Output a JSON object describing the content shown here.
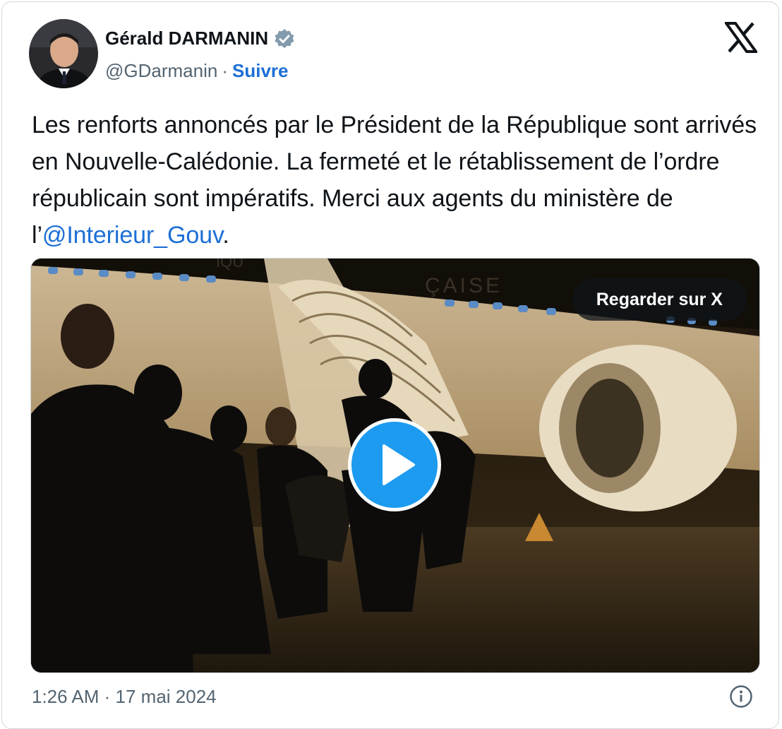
{
  "author": {
    "name": "Gérald DARMANIN",
    "handle": "@GDarmanin",
    "separator": "·",
    "follow_label": "Suivre",
    "verified_icon": "verified-badge-icon"
  },
  "tweet": {
    "text_before_mention": "Les renforts annoncés par le Président de la République sont arrivés en Nouvelle-Calédonie. La fermeté et le rétablissement de l’ordre républicain sont impératifs. Merci aux agents du ministère de l’",
    "mention": "@Interieur_Gouv",
    "text_after_mention": "."
  },
  "media": {
    "watch_label": "Regarder sur X",
    "fuselage_text": "ÇAISE",
    "fuselage_text_left": "IQU"
  },
  "meta": {
    "time": "1:26 AM",
    "separator": "·",
    "date": "17 mai 2024"
  },
  "colors": {
    "link": "#1d6fd6",
    "play": "#1d9bf0",
    "text": "#0f1419",
    "muted": "#536471"
  }
}
